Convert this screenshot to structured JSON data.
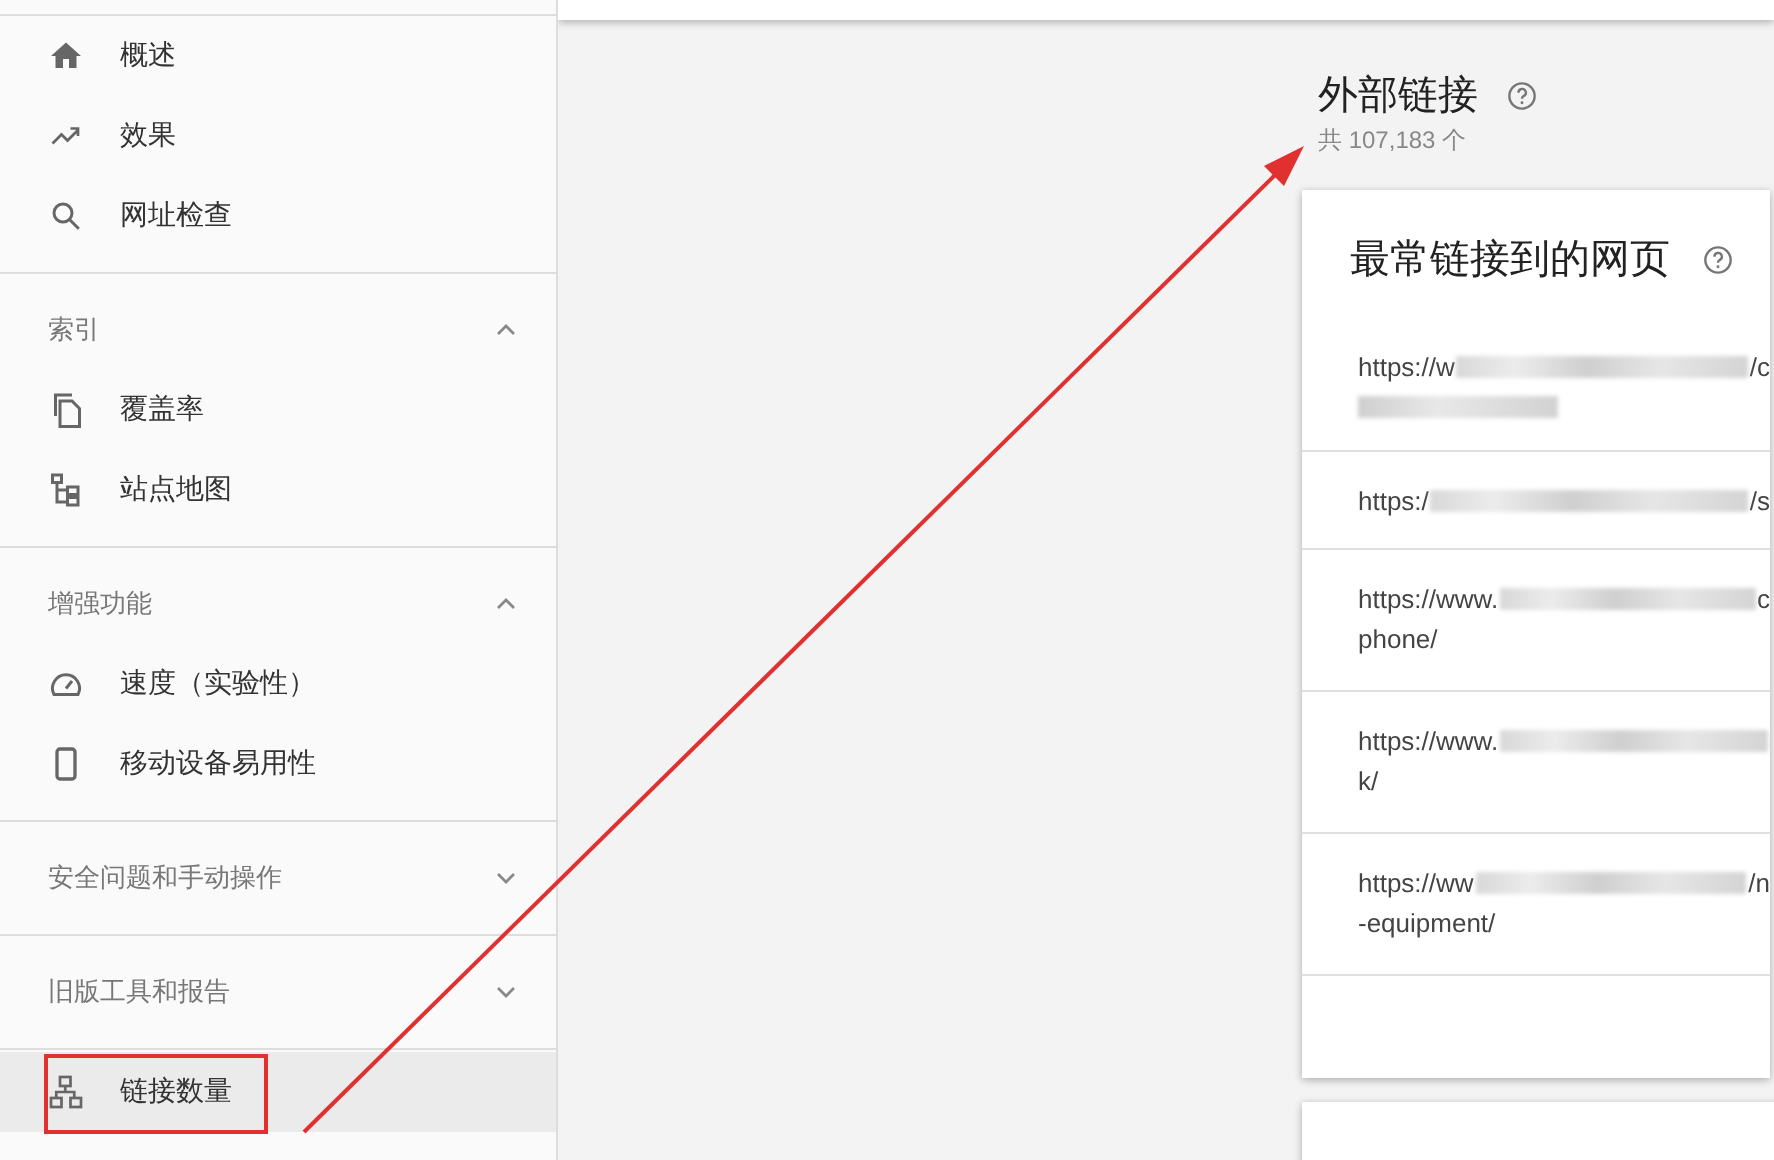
{
  "sidebar": {
    "groups": [
      {
        "items": [
          {
            "label": "概述",
            "selected": false
          },
          {
            "label": "效果",
            "selected": false
          },
          {
            "label": "网址检查",
            "selected": false
          }
        ]
      },
      {
        "header": "索引",
        "expanded": true,
        "items": [
          {
            "label": "覆盖率",
            "selected": false
          },
          {
            "label": "站点地图",
            "selected": false
          }
        ]
      },
      {
        "header": "增强功能",
        "expanded": true,
        "items": [
          {
            "label": "速度（实验性）",
            "selected": false
          },
          {
            "label": "移动设备易用性",
            "selected": false
          }
        ]
      },
      {
        "header": "安全问题和手动操作",
        "expanded": false
      },
      {
        "header": "旧版工具和报告",
        "expanded": false
      },
      {
        "items": [
          {
            "label": "链接数量",
            "selected": true,
            "highlighted": true
          }
        ]
      }
    ]
  },
  "main": {
    "title": "外部链接",
    "subtitle": "共 107,183 个",
    "card": {
      "title": "最常链接到的网页",
      "rows": [
        {
          "start": "https://w",
          "end": "/c",
          "second_line_blurred": true
        },
        {
          "start": "https:/",
          "end": "/s"
        },
        {
          "start": "https://www.",
          "end": "c",
          "second_line": "phone/"
        },
        {
          "start": "https://www.",
          "second_line": "k/"
        },
        {
          "start": "https://ww",
          "end": "/n",
          "second_line": "-equipment/"
        }
      ]
    }
  }
}
